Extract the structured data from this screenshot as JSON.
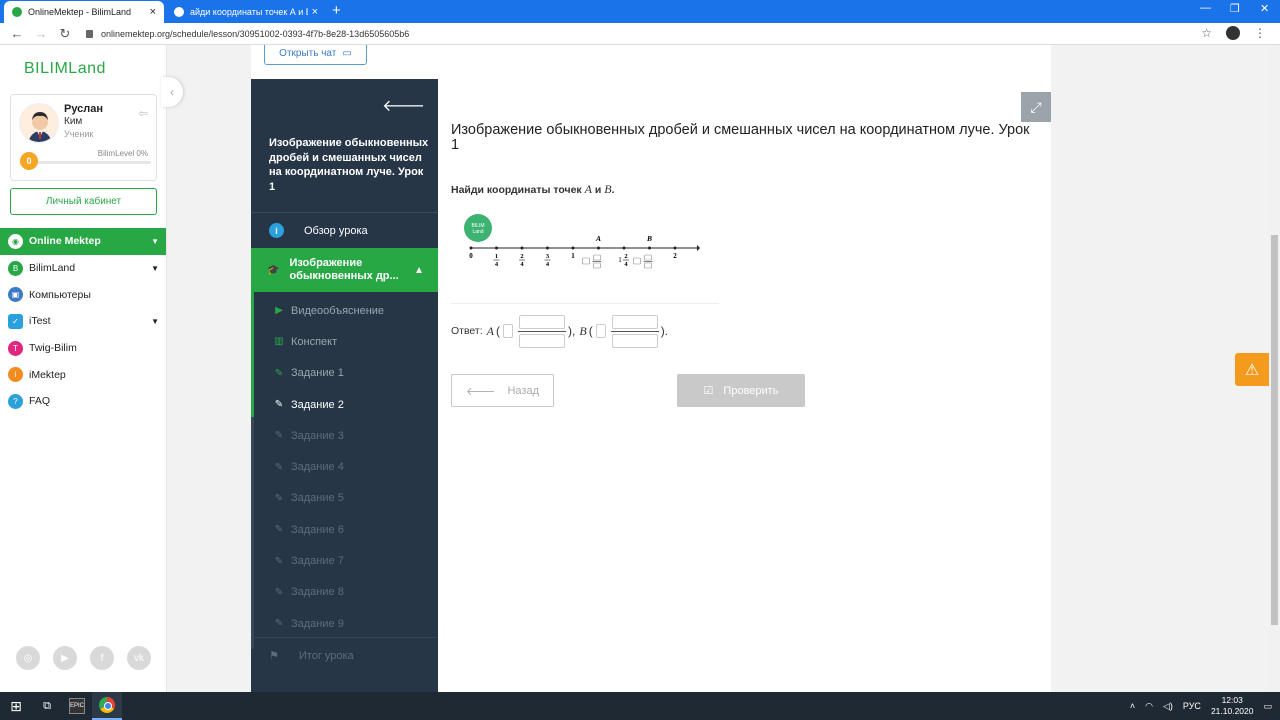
{
  "browser": {
    "tabs": [
      {
        "title": "OnlineMektep - BilimLand",
        "favicon_color": "#28a745"
      },
      {
        "title": "айди координаты точек А и В. -",
        "favicon_color": "#ffffff"
      }
    ],
    "url": "onlinemektep.org/schedule/lesson/30951002-0393-4f7b-8e28-13d6505605b6"
  },
  "sidebar": {
    "logo": "BILIMLand",
    "user": {
      "first_name": "Руслан",
      "last_name": "Ким",
      "role": "Ученик",
      "level_label": "BilimLevel 0%",
      "coins": "0"
    },
    "cabinet_label": "Личный кабинет",
    "menu": [
      {
        "label": "Online Mektep",
        "color": "#28a745",
        "chevron": true,
        "active": true
      },
      {
        "label": "BilimLand",
        "color": "#28a745",
        "chevron": true,
        "active": false
      },
      {
        "label": "Компьютеры",
        "color": "#3b7bc4",
        "chevron": false,
        "active": false
      },
      {
        "label": "iTest",
        "color": "#2aa1dc",
        "chevron": true,
        "active": false
      },
      {
        "label": "Twig-Bilim",
        "color": "#e0267f",
        "chevron": false,
        "active": false
      },
      {
        "label": "iMektep",
        "color": "#f28c1e",
        "chevron": false,
        "active": false
      },
      {
        "label": "FAQ",
        "color": "#2aa1dc",
        "chevron": false,
        "active": false
      }
    ]
  },
  "chat_button": "Открыть чат",
  "lesson_panel": {
    "title": "Изображение обыкновенных дробей и смешанных чисел на координатном луче. Урок 1",
    "overview": "Обзор урока",
    "section": "Изображение обыкновенных др...",
    "items": [
      {
        "label": "Видеообъяснение",
        "icon": "play-icon",
        "state": "done"
      },
      {
        "label": "Конспект",
        "icon": "book-icon",
        "state": "done"
      },
      {
        "label": "Задание 1",
        "icon": "edit-icon",
        "state": "done"
      },
      {
        "label": "Задание 2",
        "icon": "edit-icon",
        "state": "current"
      },
      {
        "label": "Задание 3",
        "icon": "edit-icon",
        "state": "locked"
      },
      {
        "label": "Задание 4",
        "icon": "edit-icon",
        "state": "locked"
      },
      {
        "label": "Задание 5",
        "icon": "edit-icon",
        "state": "locked"
      },
      {
        "label": "Задание 6",
        "icon": "edit-icon",
        "state": "locked"
      },
      {
        "label": "Задание 7",
        "icon": "edit-icon",
        "state": "locked"
      },
      {
        "label": "Задание 8",
        "icon": "edit-icon",
        "state": "locked"
      },
      {
        "label": "Задание 9",
        "icon": "edit-icon",
        "state": "locked"
      }
    ],
    "final": "Итог урока"
  },
  "lesson": {
    "title": "Изображение обыкновенных дробей и смешанных чисел на координатном луче. Урок 1",
    "task_prefix": "Найди координаты точек",
    "point_a": "A",
    "conj": "и",
    "point_b": "B",
    "task_suffix": ".",
    "numline": {
      "logo_text": "BILIM Land",
      "ticks": [
        "0",
        "1/4",
        "2/4",
        "3/4",
        "1",
        "",
        "1 2/4",
        "",
        "2"
      ],
      "point_a_label": "A",
      "point_b_label": "B"
    },
    "answer_label": "Ответ:",
    "answer_a": "A",
    "answer_b": "B",
    "back_label": "Назад",
    "check_label": "Проверить"
  },
  "taskbar": {
    "lang": "РУС",
    "time": "12:03",
    "date": "21.10.2020"
  }
}
